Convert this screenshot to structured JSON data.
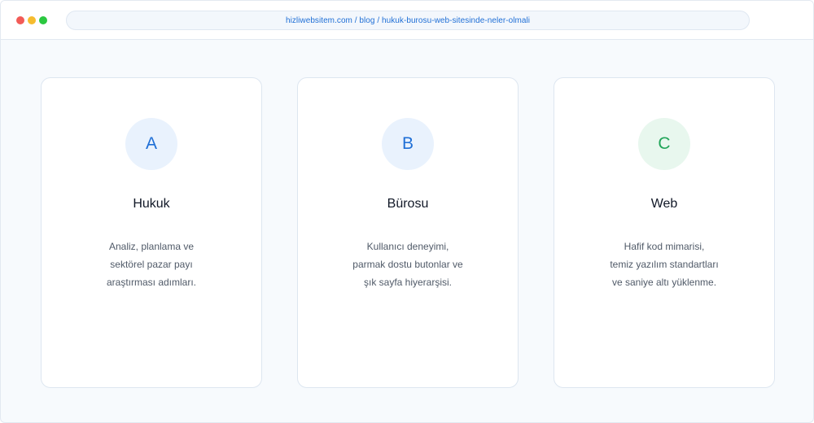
{
  "browser": {
    "url": "hizliwebsitem.com / blog / hukuk-burosu-web-sitesinde-neler-olmali"
  },
  "cards": [
    {
      "letter": "A",
      "title": "Hukuk",
      "lines": [
        "Analiz, planlama ve",
        "sektörel pazar payı",
        "araştırması adımları."
      ]
    },
    {
      "letter": "B",
      "title": "Bürosu",
      "lines": [
        "Kullanıcı deneyimi,",
        "parmak dostu butonlar ve",
        "şık sayfa hiyerarşisi."
      ]
    },
    {
      "letter": "C",
      "title": "Web",
      "lines": [
        "Hafif kod mimarisi,",
        "temiz yazılım standartları",
        "ve saniye altı yüklenme."
      ]
    }
  ],
  "colors": {
    "accent_blue": "#1f6fd6",
    "accent_green": "#22a55a",
    "window_close": "#f25b57",
    "window_minimize": "#f6bc2f",
    "window_maximize": "#2bc840"
  }
}
